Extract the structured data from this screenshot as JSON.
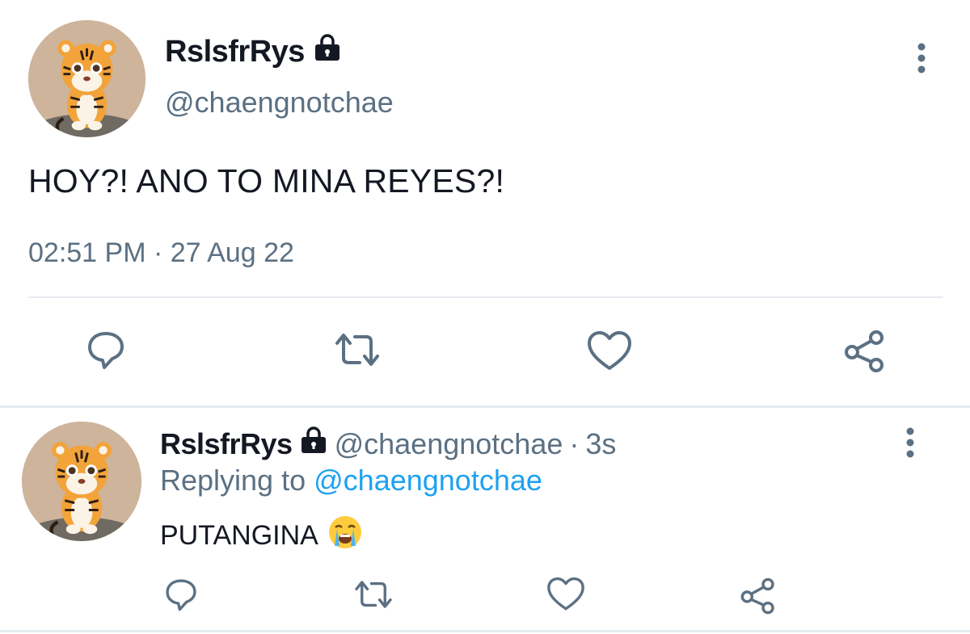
{
  "main_tweet": {
    "display_name": "RslsfrRys",
    "handle": "@chaengnotchae",
    "text": "HOY?! ANO TO MINA REYES?!",
    "timestamp": "02:51 PM · 27 Aug 22",
    "icons": {
      "protected": "lock-icon",
      "menu": "more-vertical-icon",
      "reply": "reply-icon",
      "retweet": "retweet-icon",
      "like": "heart-icon",
      "share": "share-icon"
    }
  },
  "reply_tweet": {
    "display_name": "RslsfrRys",
    "handle": "@chaengnotchae",
    "separator": "·",
    "time": "3s",
    "replying_prefix": "Replying to",
    "replying_target": "@chaengnotchae",
    "text": "PUTANGINA",
    "emoji": "crying-face-emoji"
  },
  "colors": {
    "text": "#141823",
    "secondary": "#5b7083",
    "link": "#1da1f2",
    "divider": "#e6ecf0"
  }
}
